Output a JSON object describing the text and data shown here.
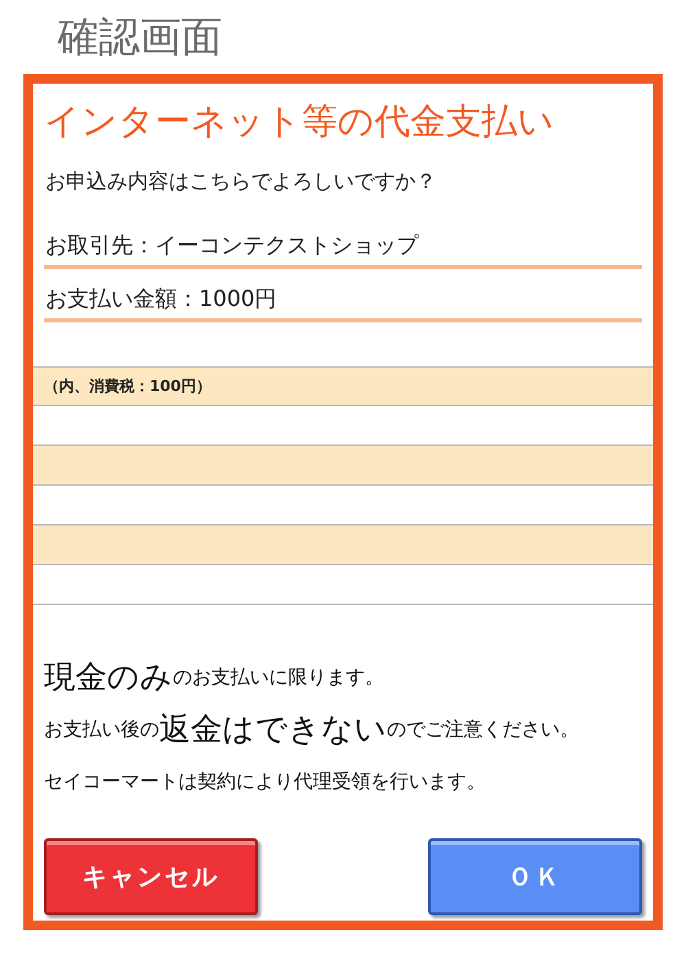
{
  "screen_title": "確認画面",
  "dialog": {
    "heading": "インターネット等の代金支払い",
    "question": "お申込み内容はこちらでよろしいですか？",
    "fields": [
      {
        "text": "お取引先：イーコンテクストショップ"
      },
      {
        "text": "お支払い金額：1000円"
      }
    ],
    "tax_note": "（内、消費税：100円）",
    "notices": [
      [
        {
          "text": "現金のみ",
          "emphasis": true
        },
        {
          "text": "のお支払いに限ります。",
          "emphasis": false
        }
      ],
      [
        {
          "text": "お支払い後の",
          "emphasis": false
        },
        {
          "text": "返金はできない",
          "emphasis": true
        },
        {
          "text": "のでご注意ください。",
          "emphasis": false
        }
      ],
      [
        {
          "text": "セイコーマートは契約により代理受領を行います。",
          "emphasis": false
        }
      ]
    ],
    "buttons": [
      {
        "label": "キャンセル",
        "kind": "cancel"
      },
      {
        "label": "ＯＫ",
        "kind": "ok"
      }
    ]
  }
}
